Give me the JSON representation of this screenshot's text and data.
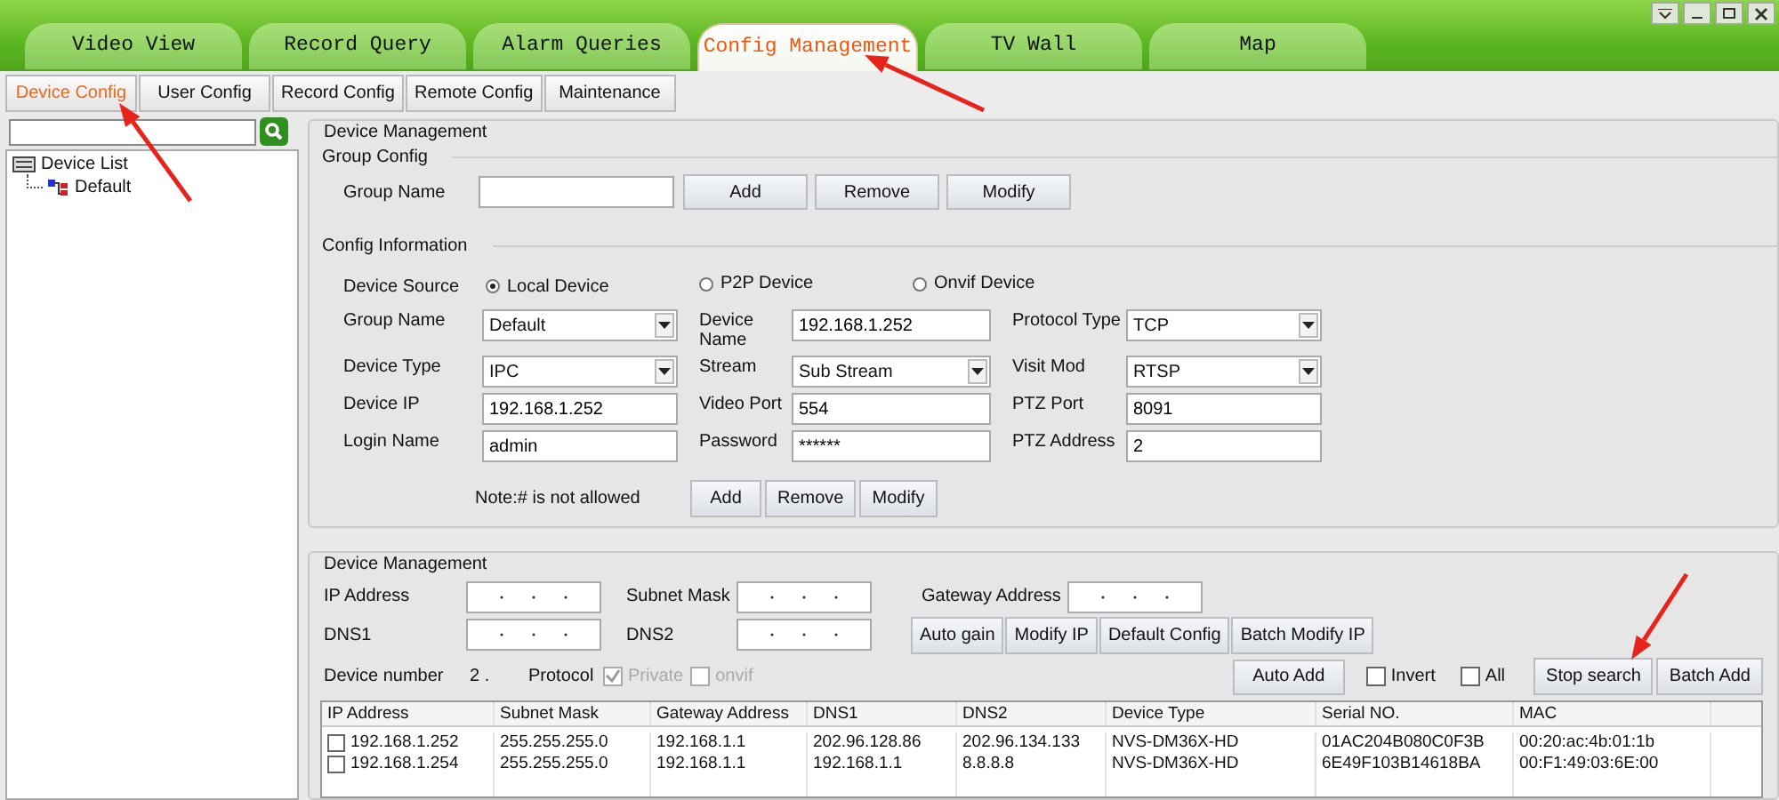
{
  "tabs": [
    {
      "label": "Video View",
      "selected": false
    },
    {
      "label": "Record Query",
      "selected": false
    },
    {
      "label": "Alarm Queries",
      "selected": false
    },
    {
      "label": "Config Management",
      "selected": true
    },
    {
      "label": "TV Wall",
      "selected": false
    },
    {
      "label": "Map",
      "selected": false
    }
  ],
  "subtabs": [
    {
      "label": "Device Config",
      "selected": true
    },
    {
      "label": "User Config",
      "selected": false
    },
    {
      "label": "Record Config",
      "selected": false
    },
    {
      "label": "Remote Config",
      "selected": false
    },
    {
      "label": "Maintenance",
      "selected": false
    }
  ],
  "sidebar": {
    "tree": [
      {
        "label": "Device List",
        "expanded": true,
        "children": [
          {
            "label": "Default"
          }
        ]
      }
    ]
  },
  "device_management": {
    "title": "Device Management",
    "group_config": {
      "title": "Group Config",
      "label": "Group Name",
      "buttons": [
        "Add",
        "Remove",
        "Modify"
      ]
    },
    "config_information": {
      "title": "Config Information",
      "source_label": "Device Source",
      "sources": [
        {
          "label": "Local Device",
          "selected": true
        },
        {
          "label": "P2P Device",
          "selected": false
        },
        {
          "label": "Onvif Device",
          "selected": false
        }
      ],
      "fields": [
        {
          "label": "Group Name",
          "kind": "select",
          "value": "Default"
        },
        {
          "label": "Device Name",
          "kind": "text",
          "value": "192.168.1.252"
        },
        {
          "label": "Protocol Type",
          "kind": "select",
          "value": "TCP"
        },
        {
          "label": "Device Type",
          "kind": "select",
          "value": "IPC"
        },
        {
          "label": "Stream",
          "kind": "select",
          "value": "Sub Stream"
        },
        {
          "label": "Visit Mod",
          "kind": "select",
          "value": "RTSP"
        },
        {
          "label": "Device IP",
          "kind": "text",
          "value": "192.168.1.252"
        },
        {
          "label": "Video Port",
          "kind": "text",
          "value": "554"
        },
        {
          "label": "PTZ Port",
          "kind": "text",
          "value": "8091"
        },
        {
          "label": "Login Name",
          "kind": "text",
          "value": "admin"
        },
        {
          "label": "Password",
          "kind": "text",
          "value": "******"
        },
        {
          "label": "PTZ Address",
          "kind": "text",
          "value": "2"
        }
      ],
      "note": "Note:# is not allowed",
      "buttons": [
        "Add",
        "Remove",
        "Modify"
      ]
    }
  },
  "network": {
    "title": "Device Management",
    "ip_fields": [
      {
        "label": "IP Address"
      },
      {
        "label": "Subnet Mask"
      },
      {
        "label": "Gateway Address"
      },
      {
        "label": "DNS1"
      },
      {
        "label": "DNS2"
      }
    ],
    "buttons": [
      "Auto gain",
      "Modify IP",
      "Default Config",
      "Batch Modify IP"
    ],
    "device_number_label": "Device number",
    "device_number": "2 .",
    "protocol_label": "Protocol",
    "protocols": [
      {
        "label": "Private",
        "checked": true,
        "disabled": true
      },
      {
        "label": "onvif",
        "checked": false,
        "disabled": true
      }
    ],
    "auto_add": "Auto Add",
    "options": [
      {
        "label": "Invert",
        "checked": false
      },
      {
        "label": "All",
        "checked": false
      }
    ],
    "actions": [
      "Stop search",
      "Batch Add"
    ],
    "table": {
      "columns": [
        "IP Address",
        "Subnet Mask",
        "Gateway Address",
        "DNS1",
        "DNS2",
        "Device Type",
        "Serial NO.",
        "MAC"
      ],
      "rows": [
        {
          "checked": false,
          "cells": [
            "192.168.1.252",
            "255.255.255.0",
            "192.168.1.1",
            "202.96.128.86",
            "202.96.134.133",
            "NVS-DM36X-HD",
            "01AC204B080C0F3B",
            "00:20:ac:4b:01:1b"
          ]
        },
        {
          "checked": false,
          "cells": [
            "192.168.1.254",
            "255.255.255.0",
            "192.168.1.1",
            "192.168.1.1",
            "8.8.8.8",
            "NVS-DM36X-HD",
            "6E49F103B14618BA",
            "00:F1:49:03:6E:00"
          ]
        }
      ]
    }
  }
}
